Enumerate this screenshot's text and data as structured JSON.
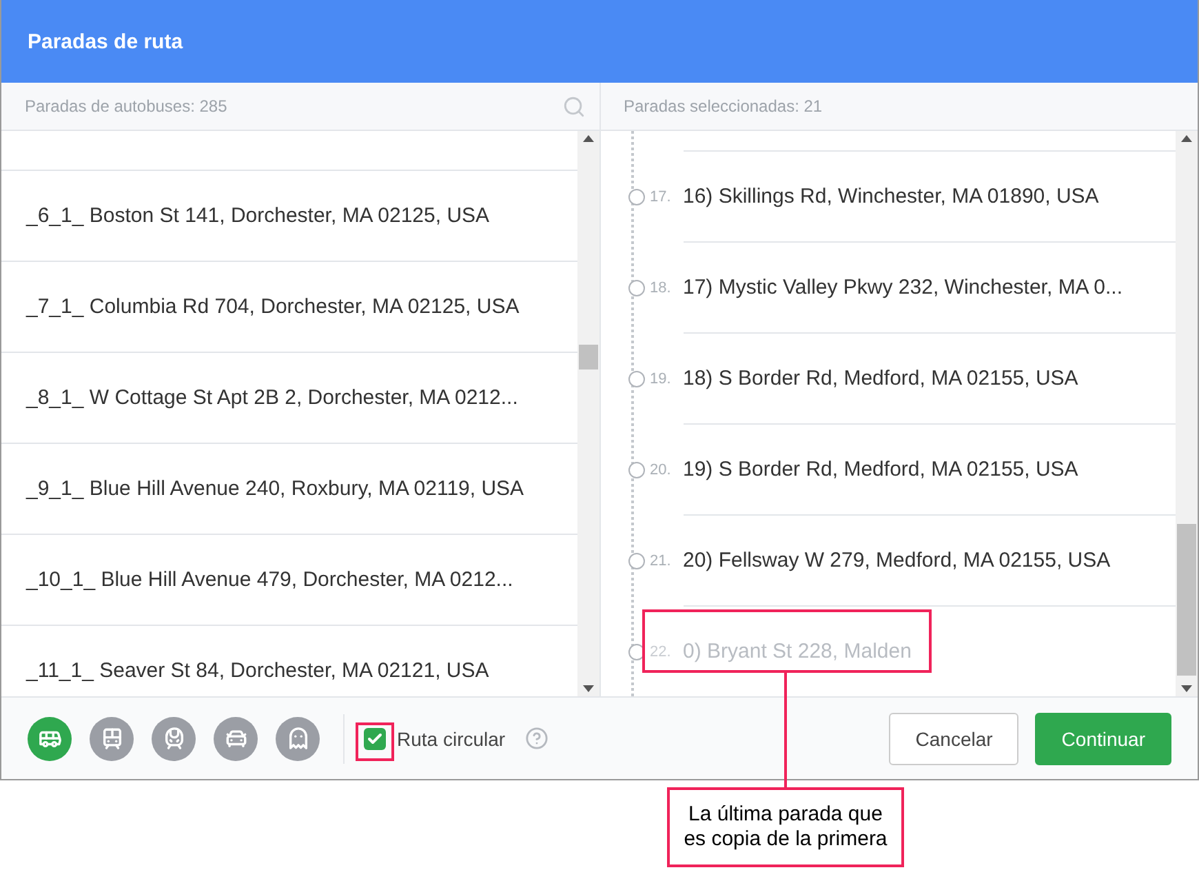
{
  "window": {
    "title": "Paradas de ruta"
  },
  "available": {
    "heading": "Paradas de autobuses: 285",
    "items": [
      {
        "label": "_6_1_ Boston St 141, Dorchester, MA 02125, USA"
      },
      {
        "label": "_7_1_ Columbia Rd 704, Dorchester, MA 02125, USA"
      },
      {
        "label": "_8_1_ W Cottage St Apt 2B 2, Dorchester, MA 0212..."
      },
      {
        "label": "_9_1_ Blue Hill Avenue 240, Roxbury, MA 02119, USA"
      },
      {
        "label": "_10_1_ Blue Hill Avenue 479, Dorchester, MA 0212..."
      },
      {
        "label": "_11_1_ Seaver St 84, Dorchester, MA 02121, USA"
      }
    ]
  },
  "selected_stops": {
    "heading": "Paradas seleccionadas: 21",
    "items": [
      {
        "number": "17.",
        "label": "16) Skillings Rd, Winchester, MA 01890, USA",
        "disabled": false
      },
      {
        "number": "18.",
        "label": "17) Mystic Valley Pkwy 232, Winchester, MA 0...",
        "disabled": false
      },
      {
        "number": "19.",
        "label": "18) S Border Rd, Medford, MA 02155, USA",
        "disabled": false
      },
      {
        "number": "20.",
        "label": "19) S Border Rd, Medford, MA 02155, USA",
        "disabled": false
      },
      {
        "number": "21.",
        "label": "20) Fellsway W 279, Medford, MA 02155, USA",
        "disabled": false
      },
      {
        "number": "22.",
        "label": "0) Bryant St 228, Malden",
        "disabled": true
      }
    ]
  },
  "vehicle_types": [
    {
      "kind": "bus",
      "selected": true
    },
    {
      "kind": "tram",
      "selected": false
    },
    {
      "kind": "train",
      "selected": false
    },
    {
      "kind": "car",
      "selected": false
    },
    {
      "kind": "ghost",
      "selected": false
    }
  ],
  "circular_route": {
    "label": "Ruta circular",
    "checked": true
  },
  "buttons": {
    "cancel": "Cancelar",
    "continue": "Continuar"
  },
  "callout": {
    "text": "La última parada que es copia de la primera"
  }
}
